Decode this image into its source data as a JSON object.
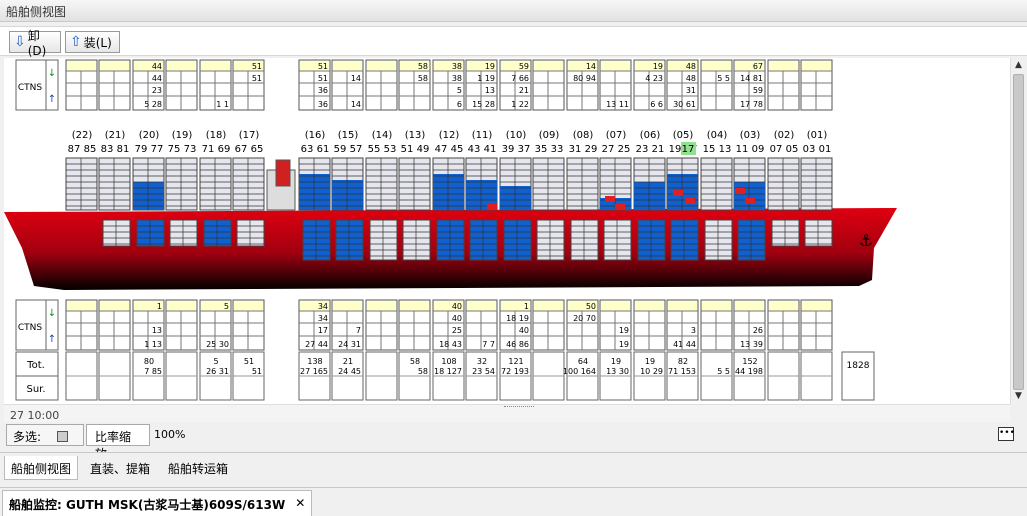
{
  "window_title": "船舶侧视图",
  "toolbar": {
    "unload_label": "卸(D)",
    "load_label": "装(L)"
  },
  "ctns_label": "CTNS",
  "bays_top": [
    {
      "lbl": "(22)",
      "rows": [
        "87 85"
      ]
    },
    {
      "lbl": "(21)",
      "rows": [
        "83 81"
      ]
    },
    {
      "lbl": "(20)",
      "rows": [
        "79 77"
      ]
    },
    {
      "lbl": "(19)",
      "rows": [
        "75 73"
      ]
    },
    {
      "lbl": "(18)",
      "rows": [
        "71 69"
      ]
    },
    {
      "lbl": "(17)",
      "rows": [
        "67 65"
      ]
    },
    {
      "lbl": "(16)",
      "rows": [
        "63 61"
      ]
    },
    {
      "lbl": "(15)",
      "rows": [
        "59 57"
      ]
    },
    {
      "lbl": "(14)",
      "rows": [
        "55 53"
      ]
    },
    {
      "lbl": "(13)",
      "rows": [
        "51 49"
      ]
    },
    {
      "lbl": "(12)",
      "rows": [
        "47 45"
      ]
    },
    {
      "lbl": "(11)",
      "rows": [
        "43 41"
      ]
    },
    {
      "lbl": "(10)",
      "rows": [
        "39 37"
      ]
    },
    {
      "lbl": "(09)",
      "rows": [
        "35 33"
      ]
    },
    {
      "lbl": "(08)",
      "rows": [
        "31 29"
      ]
    },
    {
      "lbl": "(07)",
      "rows": [
        "27 25"
      ]
    },
    {
      "lbl": "(06)",
      "rows": [
        "23 21"
      ]
    },
    {
      "lbl": "(05)",
      "rows": [
        "19 17"
      ]
    },
    {
      "lbl": "(04)",
      "rows": [
        "15 13"
      ]
    },
    {
      "lbl": "(03)",
      "rows": [
        "11 09"
      ]
    },
    {
      "lbl": "(02)",
      "rows": [
        "07 05"
      ]
    },
    {
      "lbl": "(01)",
      "rows": [
        "03 01"
      ]
    }
  ],
  "upper_counts": [
    [
      "",
      "",
      "",
      ""
    ],
    [
      "",
      "",
      "",
      ""
    ],
    [
      "44",
      "44",
      "23",
      "5 28"
    ],
    [
      "",
      "",
      "",
      ""
    ],
    [
      "",
      "",
      "",
      "1 1"
    ],
    [
      "51",
      "51",
      "",
      ""
    ],
    [
      "51",
      "51",
      "36",
      "36"
    ],
    [
      "",
      "14",
      "",
      "14"
    ],
    [
      "",
      "",
      "",
      ""
    ],
    [
      "58",
      "58",
      "",
      ""
    ],
    [
      "38",
      "38",
      "5",
      "6"
    ],
    [
      "19",
      "1 19",
      "13",
      "15 28"
    ],
    [
      "59",
      "7 66",
      "21",
      "1 22"
    ],
    [
      "",
      "",
      "",
      ""
    ],
    [
      "14",
      "80 94",
      "",
      ""
    ],
    [
      "",
      "",
      "",
      "13 11"
    ],
    [
      "19",
      "4 23",
      "",
      "6 6"
    ],
    [
      "48",
      "48",
      "31",
      "30 61"
    ],
    [
      "",
      "5 5",
      "",
      ""
    ],
    [
      "67",
      "14 81",
      "59",
      "17 78"
    ],
    [
      "",
      "",
      "",
      ""
    ],
    [
      "",
      "",
      "",
      ""
    ]
  ],
  "lower_counts": [
    [
      "",
      "",
      "",
      ""
    ],
    [
      "",
      "",
      "",
      ""
    ],
    [
      "1",
      "",
      "13",
      "1 13"
    ],
    [
      "",
      "",
      "",
      ""
    ],
    [
      "5",
      "",
      "",
      "25 30"
    ],
    [
      "",
      "",
      "",
      ""
    ],
    [
      "34",
      "34",
      "17",
      "27 44"
    ],
    [
      "",
      "",
      "7",
      "24 31"
    ],
    [
      "",
      "",
      "",
      ""
    ],
    [
      "",
      "",
      "",
      ""
    ],
    [
      "40",
      "40",
      "25",
      "18 43"
    ],
    [
      "",
      "",
      "",
      "7 7"
    ],
    [
      "1",
      "18 19",
      "40",
      "46 86"
    ],
    [
      "",
      "",
      "",
      ""
    ],
    [
      "50",
      "20 70",
      "",
      ""
    ],
    [
      "",
      "",
      "19",
      "19"
    ],
    [
      "",
      "",
      "",
      ""
    ],
    [
      "",
      "",
      "3",
      "41 44"
    ],
    [
      "",
      "",
      "",
      ""
    ],
    [
      "",
      "",
      "26",
      "13 39"
    ],
    [
      "",
      "",
      "",
      ""
    ],
    [
      "",
      "",
      "",
      ""
    ]
  ],
  "totals": {
    "tot_label": "Tot.",
    "sur_label": "Sur.",
    "tot": [
      "",
      "",
      "80",
      "",
      "5",
      "51",
      "138",
      "21",
      "",
      "58",
      "108",
      "32",
      "121",
      "",
      "64",
      "19",
      "19",
      "82",
      "",
      "152",
      "",
      ""
    ],
    "sur": [
      "",
      "",
      "7 85",
      "",
      "26 31",
      "51",
      "27 165",
      "24 45",
      "",
      "58",
      "18 127",
      "23 54",
      "72 193",
      "",
      "100 164",
      "13 30",
      "10 29",
      "71 153",
      "5 5",
      "44 198",
      "",
      ""
    ],
    "grand_total": "1828"
  },
  "highlight_bay": "17",
  "hscroll_time": "27 10:00",
  "status": {
    "multiselect_label": "多选:",
    "zoom_button": "比率缩放",
    "zoom_value": "100%"
  },
  "bottom_tabs": [
    "船舶侧视图",
    "直装、提箱",
    "船舶转运箱"
  ],
  "doc_tab": "船舶监控: GUTH MSK(古浆马士基)609S/613W",
  "colors": {
    "hull_red": "#e00010",
    "load_blue": "#1060d0",
    "cell_yellow": "#ffffc8",
    "hold_red": "#e02020"
  }
}
